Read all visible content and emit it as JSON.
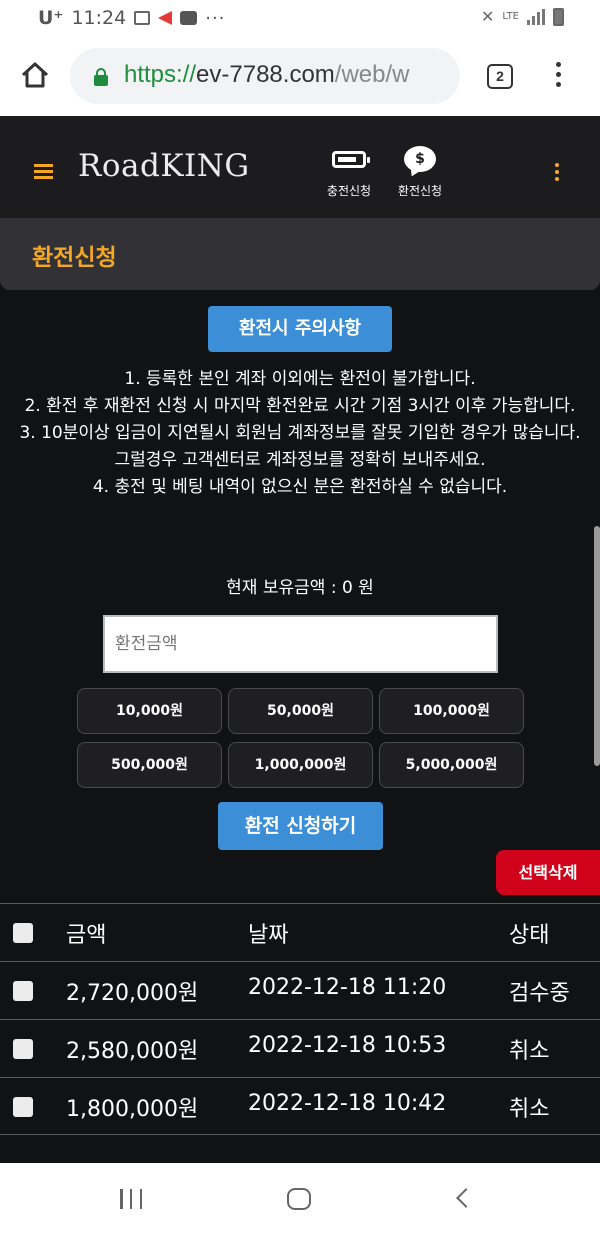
{
  "status_bar": {
    "carrier": "U⁺",
    "time": "11:24",
    "more": "···",
    "network": "LTE"
  },
  "browser": {
    "url_scheme": "https://",
    "url_host": "ev-7788.com",
    "url_path": "/web/w",
    "tab_count": "2"
  },
  "header": {
    "logo": "RoadKING",
    "buttons": [
      {
        "label": "충전신청",
        "icon": "battery-icon"
      },
      {
        "label": "환전신청",
        "icon": "dollar-chat-icon"
      }
    ]
  },
  "page": {
    "title": "환전신청",
    "notice_button": "환전시 주의사항",
    "notice_lines": [
      "1. 등록한 본인 계좌 이외에는 환전이 불가합니다.",
      "2. 환전 후 재환전 신청 시 마지막 환전완료 시간 기점 3시간 이후 가능합니다.",
      "3. 10분이상 입금이 지연될시 회원님 계좌정보를 잘못 기입한 경우가 많습니다.",
      "그럴경우 고객센터로 계좌정보를 정확히 보내주세요.",
      "4. 충전 및 베팅 내역이 없으신 분은 환전하실 수 없습니다."
    ],
    "balance_text": "현재 보유금액 : 0 원",
    "amount_placeholder": "환전금액",
    "amount_buttons": [
      "10,000원",
      "50,000원",
      "100,000원",
      "500,000원",
      "1,000,000원",
      "5,000,000원"
    ],
    "submit_button": "환전 신청하기",
    "delete_button": "선택삭제"
  },
  "table": {
    "headers": {
      "amount": "금액",
      "date": "날짜",
      "status": "상태"
    },
    "rows": [
      {
        "amount": "2,720,000원",
        "date": "2022-12-18 11:20",
        "status": "검수중"
      },
      {
        "amount": "2,580,000원",
        "date": "2022-12-18 10:53",
        "status": "취소"
      },
      {
        "amount": "1,800,000원",
        "date": "2022-12-18 10:42",
        "status": "취소"
      }
    ]
  },
  "colors": {
    "accent": "#f5a623",
    "button_blue": "#3c8fd6",
    "delete_red": "#d0021b",
    "background": "#111214"
  }
}
